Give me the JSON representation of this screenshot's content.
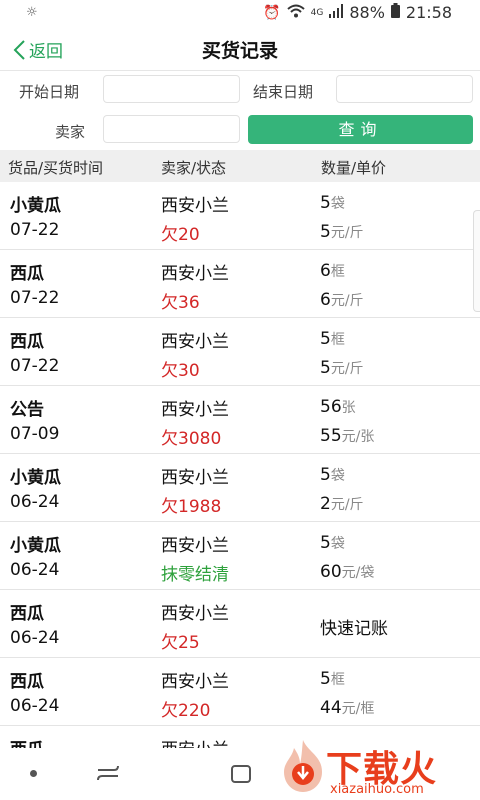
{
  "status_bar": {
    "battery": "88%",
    "time": "21:58",
    "network": "4G"
  },
  "header": {
    "back_label": "返回",
    "title": "买货记录"
  },
  "filter": {
    "start_date_label": "开始日期",
    "end_date_label": "结束日期",
    "seller_label": "卖家",
    "query_label": "查询",
    "start_date_value": "",
    "end_date_value": "",
    "seller_value": ""
  },
  "table": {
    "columns": [
      "货品/买货时间",
      "卖家/状态",
      "数量/单价"
    ],
    "rows": [
      {
        "goods": "小黄瓜",
        "date": "07-22",
        "seller": "西安小兰",
        "status": "欠20",
        "status_color": "#d32727",
        "qty": "5",
        "qty_unit": "袋",
        "price": "5",
        "price_unit": "元/斤"
      },
      {
        "goods": "西瓜",
        "date": "07-22",
        "seller": "西安小兰",
        "status": "欠36",
        "status_color": "#d32727",
        "qty": "6",
        "qty_unit": "框",
        "price": "6",
        "price_unit": "元/斤"
      },
      {
        "goods": "西瓜",
        "date": "07-22",
        "seller": "西安小兰",
        "status": "欠30",
        "status_color": "#d32727",
        "qty": "5",
        "qty_unit": "框",
        "price": "5",
        "price_unit": "元/斤"
      },
      {
        "goods": "公告",
        "date": "07-09",
        "seller": "西安小兰",
        "status": "欠3080",
        "status_color": "#d32727",
        "qty": "56",
        "qty_unit": "张",
        "price": "55",
        "price_unit": "元/张"
      },
      {
        "goods": "小黄瓜",
        "date": "06-24",
        "seller": "西安小兰",
        "status": "欠1988",
        "status_color": "#d32727",
        "qty": "5",
        "qty_unit": "袋",
        "price": "2",
        "price_unit": "元/斤"
      },
      {
        "goods": "小黄瓜",
        "date": "06-24",
        "seller": "西安小兰",
        "status": "抹零结清",
        "status_color": "#2ea13c",
        "qty": "5",
        "qty_unit": "袋",
        "price": "60",
        "price_unit": "元/袋"
      },
      {
        "goods": "西瓜",
        "date": "06-24",
        "seller": "西安小兰",
        "status": "欠25",
        "status_color": "#d32727",
        "single": "快速记账"
      },
      {
        "goods": "西瓜",
        "date": "06-24",
        "seller": "西安小兰",
        "status": "欠220",
        "status_color": "#d32727",
        "qty": "5",
        "qty_unit": "框",
        "price": "44",
        "price_unit": "元/框"
      },
      {
        "goods": "西瓜",
        "date": "",
        "seller": "西安小兰",
        "status": "",
        "status_color": "#d32727",
        "qty": "",
        "qty_unit": "",
        "price": "",
        "price_unit": ""
      }
    ]
  },
  "watermark": {
    "name": "下载火",
    "url": "xiazaihuo.com"
  },
  "colors": {
    "accent": "#35b47a",
    "debt": "#d32727",
    "settled": "#2ea13c",
    "brand_watermark": "#e83e1c"
  }
}
